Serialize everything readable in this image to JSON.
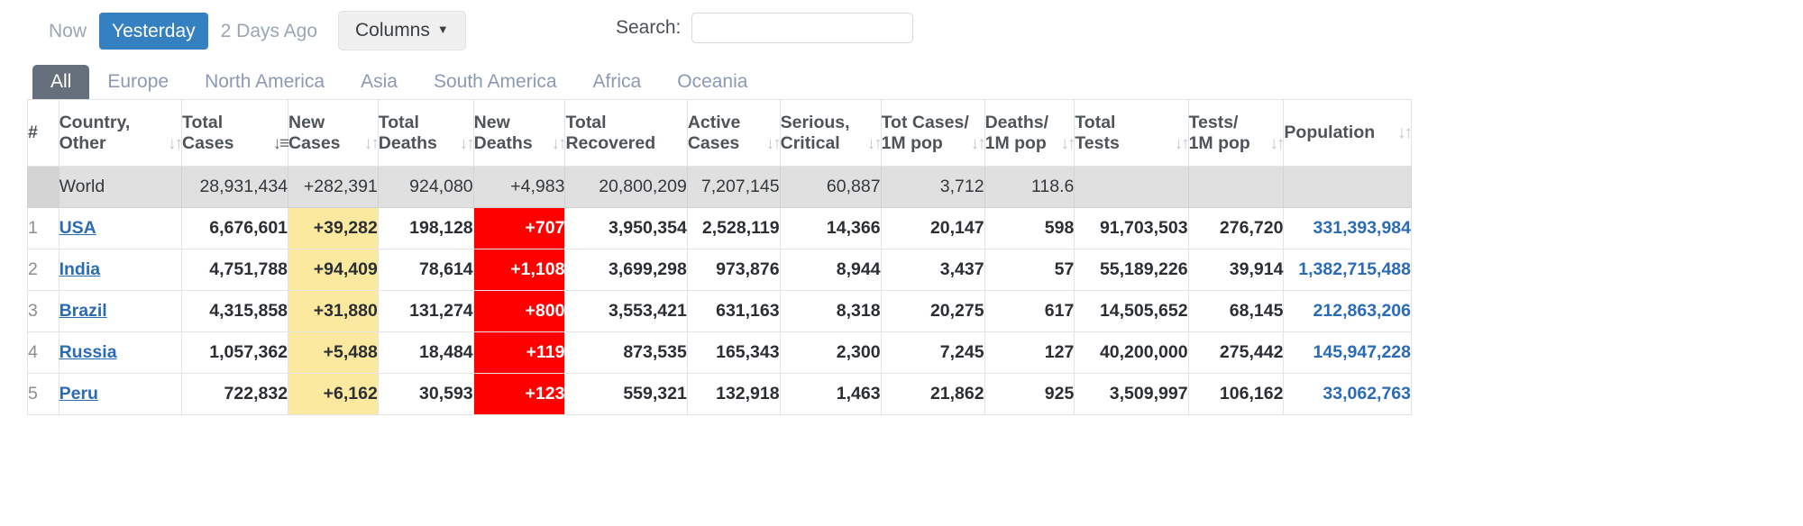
{
  "toolbar": {
    "day_links": [
      {
        "label": "Now",
        "active": false
      },
      {
        "label": "Yesterday",
        "active": true
      },
      {
        "label": "2 Days Ago",
        "active": false
      }
    ],
    "columns_button": "Columns",
    "columns_caret_icon": "caret-down-icon",
    "search_label": "Search:",
    "search_value": "",
    "search_placeholder": ""
  },
  "tabs": [
    {
      "label": "All",
      "active": true
    },
    {
      "label": "Europe",
      "active": false
    },
    {
      "label": "North America",
      "active": false
    },
    {
      "label": "Asia",
      "active": false
    },
    {
      "label": "South America",
      "active": false
    },
    {
      "label": "Africa",
      "active": false
    },
    {
      "label": "Oceania",
      "active": false
    }
  ],
  "table": {
    "columns": [
      {
        "line1": "",
        "line2": "#",
        "sort": "none",
        "key": "rank"
      },
      {
        "line1": "Country,",
        "line2": "Other",
        "sort": "both",
        "key": "country"
      },
      {
        "line1": "Total",
        "line2": "Cases",
        "sort": "desc-active",
        "key": "total_cases"
      },
      {
        "line1": "New",
        "line2": "Cases",
        "sort": "both",
        "key": "new_cases"
      },
      {
        "line1": "Total",
        "line2": "Deaths",
        "sort": "both",
        "key": "total_deaths"
      },
      {
        "line1": "New",
        "line2": "Deaths",
        "sort": "both",
        "key": "new_deaths"
      },
      {
        "line1": "Total",
        "line2": "Recovered",
        "sort": "both",
        "key": "total_recovered"
      },
      {
        "line1": "Active",
        "line2": "Cases",
        "sort": "both",
        "key": "active_cases"
      },
      {
        "line1": "Serious,",
        "line2": "Critical",
        "sort": "both",
        "key": "serious_critical"
      },
      {
        "line1": "Tot Cases/",
        "line2": "1M pop",
        "sort": "both",
        "key": "cases_per_1m"
      },
      {
        "line1": "Deaths/",
        "line2": "1M pop",
        "sort": "both",
        "key": "deaths_per_1m"
      },
      {
        "line1": "Total",
        "line2": "Tests",
        "sort": "both",
        "key": "total_tests"
      },
      {
        "line1": "Tests/",
        "line2": "1M pop",
        "sort": "both",
        "key": "tests_per_1m"
      },
      {
        "line1": "",
        "line2": "Population",
        "sort": "both",
        "key": "population"
      }
    ],
    "world_row": {
      "rank": "",
      "country": "World",
      "total_cases": "28,931,434",
      "new_cases": "+282,391",
      "total_deaths": "924,080",
      "new_deaths": "+4,983",
      "total_recovered": "20,800,209",
      "active_cases": "7,207,145",
      "serious_critical": "60,887",
      "cases_per_1m": "3,712",
      "deaths_per_1m": "118.6",
      "total_tests": "",
      "tests_per_1m": "",
      "population": ""
    },
    "rows": [
      {
        "rank": "1",
        "country": "USA",
        "total_cases": "6,676,601",
        "new_cases": "+39,282",
        "total_deaths": "198,128",
        "new_deaths": "+707",
        "total_recovered": "3,950,354",
        "active_cases": "2,528,119",
        "serious_critical": "14,366",
        "cases_per_1m": "20,147",
        "deaths_per_1m": "598",
        "total_tests": "91,703,503",
        "tests_per_1m": "276,720",
        "population": "331,393,984"
      },
      {
        "rank": "2",
        "country": "India",
        "total_cases": "4,751,788",
        "new_cases": "+94,409",
        "total_deaths": "78,614",
        "new_deaths": "+1,108",
        "total_recovered": "3,699,298",
        "active_cases": "973,876",
        "serious_critical": "8,944",
        "cases_per_1m": "3,437",
        "deaths_per_1m": "57",
        "total_tests": "55,189,226",
        "tests_per_1m": "39,914",
        "population": "1,382,715,488"
      },
      {
        "rank": "3",
        "country": "Brazil",
        "total_cases": "4,315,858",
        "new_cases": "+31,880",
        "total_deaths": "131,274",
        "new_deaths": "+800",
        "total_recovered": "3,553,421",
        "active_cases": "631,163",
        "serious_critical": "8,318",
        "cases_per_1m": "20,275",
        "deaths_per_1m": "617",
        "total_tests": "14,505,652",
        "tests_per_1m": "68,145",
        "population": "212,863,206"
      },
      {
        "rank": "4",
        "country": "Russia",
        "total_cases": "1,057,362",
        "new_cases": "+5,488",
        "total_deaths": "18,484",
        "new_deaths": "+119",
        "total_recovered": "873,535",
        "active_cases": "165,343",
        "serious_critical": "2,300",
        "cases_per_1m": "7,245",
        "deaths_per_1m": "127",
        "total_tests": "40,200,000",
        "tests_per_1m": "275,442",
        "population": "145,947,228"
      },
      {
        "rank": "5",
        "country": "Peru",
        "total_cases": "722,832",
        "new_cases": "+6,162",
        "total_deaths": "30,593",
        "new_deaths": "+123",
        "total_recovered": "559,321",
        "active_cases": "132,918",
        "serious_critical": "1,463",
        "cases_per_1m": "21,862",
        "deaths_per_1m": "925",
        "total_tests": "3,509,997",
        "tests_per_1m": "106,162",
        "population": "33,062,763"
      }
    ]
  },
  "colors": {
    "active_day": "#3580c0",
    "active_tab": "#66707c",
    "new_cases_bg": "#fbe9a0",
    "new_deaths_bg": "#fe0000",
    "world_row_bg": "#e0e0e0",
    "link": "#2b6bb5"
  }
}
